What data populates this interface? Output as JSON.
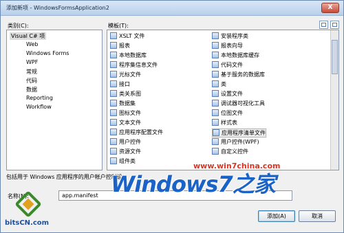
{
  "window": {
    "title": "添加新项 - WindowsFormsApplication2",
    "close_glyph": "X"
  },
  "categories": {
    "label": "类别(C):",
    "items": [
      "Visual C# 项",
      "Web",
      "Windows Forms",
      "WPF",
      "常规",
      "代码",
      "数据",
      "Reporting",
      "Workflow"
    ]
  },
  "templates": {
    "label": "模板(T):",
    "left": [
      "XSLT 文件",
      "报表",
      "本地数据库",
      "程序集信息文件",
      "光标文件",
      "接口",
      "类关系图",
      "数据集",
      "图标文件",
      "文本文件",
      "应用程序配置文件",
      "用户控件",
      "资源文件",
      "组件类"
    ],
    "right": [
      "安装程序类",
      "报表向导",
      "本地数据库缓存",
      "代码文件",
      "基于服务的数据库",
      "类",
      "设置文件",
      "调试器可视化工具",
      "位图文件",
      "样式表",
      "应用程序清单文件",
      "用户控件(WPF)",
      "自定义控件"
    ],
    "selected": "应用程序清单文件"
  },
  "description": "包括用于 Windows 应用程序的用户帐户控制设",
  "name_field": {
    "label": "名称(N):",
    "value": "app.manifest"
  },
  "buttons": {
    "add": "添加(A)",
    "cancel": "取消"
  },
  "watermark": {
    "url": "www.win7china.com",
    "main": "Windows7之家"
  },
  "logo": {
    "text": "bitsCN.com"
  }
}
